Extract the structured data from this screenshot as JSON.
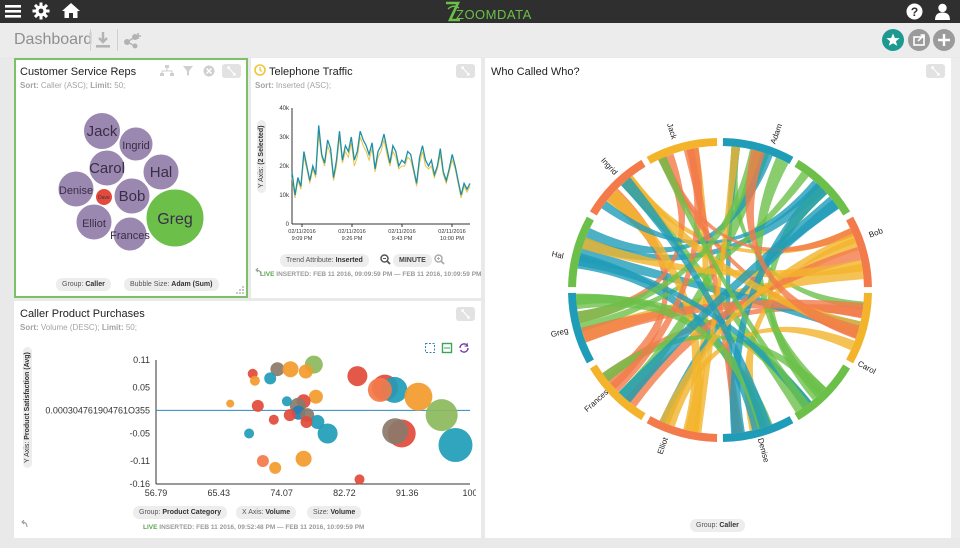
{
  "app": {
    "logo_text": "ZOOMDATA",
    "menu_icon": "hamburger-icon",
    "settings_icon": "gear-icon",
    "home_icon": "home-icon",
    "help_icon": "help-icon",
    "user_icon": "user-icon"
  },
  "toolbar": {
    "title": "Dashboard",
    "download_icon": "download-icon",
    "share_icon": "share-icon",
    "star_icon": "star-icon",
    "export_icon": "export-icon",
    "add_icon": "plus-icon"
  },
  "colors": {
    "topbar": "#2f2f2f",
    "accent_green": "#6cc04a",
    "star_button": "#1d9a8f",
    "selected_border": "#7cc067",
    "purple": "#9b88b0",
    "red": "#e24a3b",
    "teal": "#1f9cb8",
    "orange": "#f39a2b",
    "steel_blue": "#1f7fb5"
  },
  "panels": {
    "reps": {
      "title": "Customer Service Reps",
      "sort_label": "Sort:",
      "sort_value": "Caller (ASC);",
      "limit_label": "Limit:",
      "limit_value": "50;",
      "bubbles": [
        {
          "label": "Jack",
          "size": 37,
          "color": "purple"
        },
        {
          "label": "Ingrid",
          "size": 34,
          "color": "purple"
        },
        {
          "label": "Carol",
          "size": 36,
          "color": "purple"
        },
        {
          "label": "Hal",
          "size": 36,
          "color": "purple"
        },
        {
          "label": "Denise",
          "size": 36,
          "color": "purple"
        },
        {
          "label": "Dave",
          "size": 17,
          "color": "red"
        },
        {
          "label": "Bob",
          "size": 36,
          "color": "purple"
        },
        {
          "label": "Elliot",
          "size": 36,
          "color": "purple"
        },
        {
          "label": "Greg",
          "size": 58,
          "color": "green"
        },
        {
          "label": "Frances",
          "size": 34,
          "color": "purple"
        }
      ],
      "group_label": "Group:",
      "group_value": "Caller",
      "size_label": "Bubble Size:",
      "size_value": "Adam (Sum)"
    },
    "traffic": {
      "title": "Telephone Traffic",
      "sort_label": "Sort:",
      "sort_value": "Inserted (ASC);",
      "y_axis_label": "Y Axis:",
      "y_axis_value": "(2 Selected)",
      "y_ticks": [
        "40k",
        "30k",
        "20k",
        "10k",
        "0"
      ],
      "x_ticks": [
        [
          "02/11/2016",
          "9:09 PM"
        ],
        [
          "02/11/2016",
          "9:26 PM"
        ],
        [
          "02/11/2016",
          "9:43 PM"
        ],
        [
          "02/11/2016",
          "10:00 PM"
        ]
      ],
      "trend_label": "Trend Attribute:",
      "trend_value": "Inserted",
      "interval": "MINUTE",
      "live": "LIVE",
      "inserted_text": "INSERTED: FEB 11 2016, 09:09:59 PM — FEB 11 2016, 10:09:59 PM"
    },
    "purchases": {
      "title": "Caller Product Purchases",
      "sort_label": "Sort:",
      "sort_value": "Volume (DESC);",
      "limit_label": "Limit:",
      "limit_value": "50;",
      "y_axis_label": "Y Axis:",
      "y_axis_value": "Product Satisfaction (Avg)",
      "y_ticks": [
        "0.11",
        "0.05",
        "0.000304761904761O355",
        "-0.05",
        "-0.11",
        "-0.16"
      ],
      "x_ticks": [
        "56.79",
        "65.43",
        "74.07",
        "82.72",
        "91.36",
        "100"
      ],
      "group_label": "Group:",
      "group_value": "Product Category",
      "xaxis_label": "X Axis:",
      "xaxis_value": "Volume",
      "size_label": "Size:",
      "size_value": "Volume",
      "live": "LIVE",
      "inserted_text": "INSERTED: FEB 11 2016, 09:52:48 PM — FEB 11 2016, 10:09:59 PM"
    },
    "who": {
      "title": "Who Called Who?",
      "names": [
        "Adam",
        "Bob",
        "Carol",
        "Denise",
        "Elliot",
        "Frances",
        "Greg",
        "Hal",
        "Ingrid",
        "Jack"
      ],
      "group_label": "Group:",
      "group_value": "Caller"
    }
  },
  "chart_data": [
    {
      "type": "line",
      "title": "Telephone Traffic",
      "ylabel": "Y Axis: (2 Selected)",
      "ylim": [
        0,
        40000
      ],
      "x": [
        "9:09 PM",
        "",
        "",
        "",
        "",
        "",
        "",
        "",
        "",
        "",
        "",
        "",
        "",
        "",
        "",
        "",
        "",
        "9:26 PM",
        "",
        "",
        "",
        "",
        "",
        "",
        "",
        "",
        "",
        "",
        "",
        "",
        "",
        "",
        "",
        "",
        "9:43 PM",
        "",
        "",
        "",
        "",
        "",
        "",
        "",
        "",
        "",
        "",
        "",
        "",
        "",
        "",
        "",
        "",
        "10:00 PM",
        "",
        "",
        "",
        "",
        "",
        "",
        "",
        "",
        ""
      ],
      "series": [
        {
          "name": "",
          "values": [
            18000,
            10000,
            16000,
            13000,
            25000,
            20000,
            15000,
            20000,
            17000,
            34000,
            24000,
            21000,
            29000,
            26000,
            16000,
            22000,
            32000,
            22000,
            27000,
            25000,
            30000,
            22000,
            25000,
            32000,
            29000,
            27000,
            24000,
            28000,
            19000,
            25000,
            27000,
            31000,
            26000,
            21000,
            27000,
            25000,
            20000,
            22000,
            21000,
            25000,
            24000,
            19000,
            14000,
            23000,
            27000,
            22000,
            20000,
            22000,
            17000,
            20000,
            26000,
            18000,
            15000,
            19000,
            24000,
            20000,
            15000,
            10000,
            14000,
            12000,
            14000
          ]
        },
        {
          "name": "",
          "values": [
            16000,
            9000,
            15000,
            12000,
            23000,
            19000,
            14000,
            19000,
            16000,
            31000,
            23000,
            20000,
            27000,
            24000,
            15000,
            20000,
            30000,
            21000,
            25000,
            23000,
            28000,
            20000,
            23000,
            30000,
            27000,
            25000,
            22000,
            26000,
            18000,
            23000,
            25000,
            29000,
            24000,
            20000,
            25000,
            23000,
            19000,
            20000,
            20000,
            23000,
            22000,
            18000,
            13000,
            21000,
            25000,
            20000,
            19000,
            20000,
            16000,
            19000,
            24000,
            17000,
            14000,
            18000,
            22000,
            19000,
            14000,
            9000,
            13000,
            11000,
            13000
          ]
        }
      ]
    },
    {
      "type": "scatter",
      "title": "Caller Product Purchases",
      "xlabel": "X Axis: Volume",
      "ylabel": "Y Axis: Product Satisfaction (Avg)",
      "xlim": [
        56.79,
        100
      ],
      "ylim": [
        -0.16,
        0.11
      ],
      "points": [
        {
          "x": 78.5,
          "y": 0.1,
          "s": 9,
          "c": "#8cb85c"
        },
        {
          "x": 73.5,
          "y": 0.09,
          "s": 7,
          "c": "#8b7a6a"
        },
        {
          "x": 75.3,
          "y": 0.09,
          "s": 8,
          "c": "#f39a2b"
        },
        {
          "x": 77.4,
          "y": 0.085,
          "s": 7,
          "c": "#f39a2b"
        },
        {
          "x": 70.1,
          "y": 0.08,
          "s": 5,
          "c": "#e24a3b"
        },
        {
          "x": 84.5,
          "y": 0.075,
          "s": 10,
          "c": "#e24a3b"
        },
        {
          "x": 72.5,
          "y": 0.07,
          "s": 6,
          "c": "#1f9cb8"
        },
        {
          "x": 70.4,
          "y": 0.065,
          "s": 5,
          "c": "#f39a2b"
        },
        {
          "x": 88.3,
          "y": 0.05,
          "s": 13,
          "c": "#e24a3b"
        },
        {
          "x": 89.6,
          "y": 0.045,
          "s": 13,
          "c": "#1f9cb8"
        },
        {
          "x": 87.6,
          "y": 0.045,
          "s": 12,
          "c": "#f37a4a"
        },
        {
          "x": 92.9,
          "y": 0.03,
          "s": 14,
          "c": "#f39a2b"
        },
        {
          "x": 78.8,
          "y": 0.03,
          "s": 7,
          "c": "#f39a2b"
        },
        {
          "x": 77.1,
          "y": 0.02,
          "s": 7,
          "c": "#e24a3b"
        },
        {
          "x": 76.3,
          "y": 0.01,
          "s": 8,
          "c": "#8b7a6a"
        },
        {
          "x": 74.8,
          "y": 0.02,
          "s": 5,
          "c": "#1f9cb8"
        },
        {
          "x": 67.0,
          "y": 0.015,
          "s": 4,
          "c": "#f39a2b"
        },
        {
          "x": 70.8,
          "y": 0.01,
          "s": 6,
          "c": "#e24a3b"
        },
        {
          "x": 76.4,
          "y": -0.005,
          "s": 7,
          "c": "#1f7fb5"
        },
        {
          "x": 75.2,
          "y": -0.01,
          "s": 6,
          "c": "#e24a3b"
        },
        {
          "x": 77.6,
          "y": -0.01,
          "s": 7,
          "c": "#8b7a6a"
        },
        {
          "x": 79.0,
          "y": -0.025,
          "s": 7,
          "c": "#1f9cb8"
        },
        {
          "x": 77.5,
          "y": -0.025,
          "s": 6,
          "c": "#e24a3b"
        },
        {
          "x": 73.0,
          "y": -0.02,
          "s": 5,
          "c": "#e24a3b"
        },
        {
          "x": 69.6,
          "y": -0.05,
          "s": 5,
          "c": "#1f9cb8"
        },
        {
          "x": 80.4,
          "y": -0.05,
          "s": 10,
          "c": "#1f9cb8"
        },
        {
          "x": 96.1,
          "y": -0.01,
          "s": 16,
          "c": "#8cb85c"
        },
        {
          "x": 90.6,
          "y": -0.05,
          "s": 14,
          "c": "#e24a3b"
        },
        {
          "x": 89.7,
          "y": -0.045,
          "s": 13,
          "c": "#8b7a6a"
        },
        {
          "x": 98.0,
          "y": -0.075,
          "s": 17,
          "c": "#1f9cb8"
        },
        {
          "x": 71.5,
          "y": -0.11,
          "s": 6,
          "c": "#f37a4a"
        },
        {
          "x": 77.1,
          "y": -0.105,
          "s": 8,
          "c": "#f39a2b"
        },
        {
          "x": 73.2,
          "y": -0.125,
          "s": 6,
          "c": "#f39a2b"
        },
        {
          "x": 84.8,
          "y": -0.15,
          "s": 5,
          "c": "#e24a3b"
        }
      ]
    }
  ]
}
